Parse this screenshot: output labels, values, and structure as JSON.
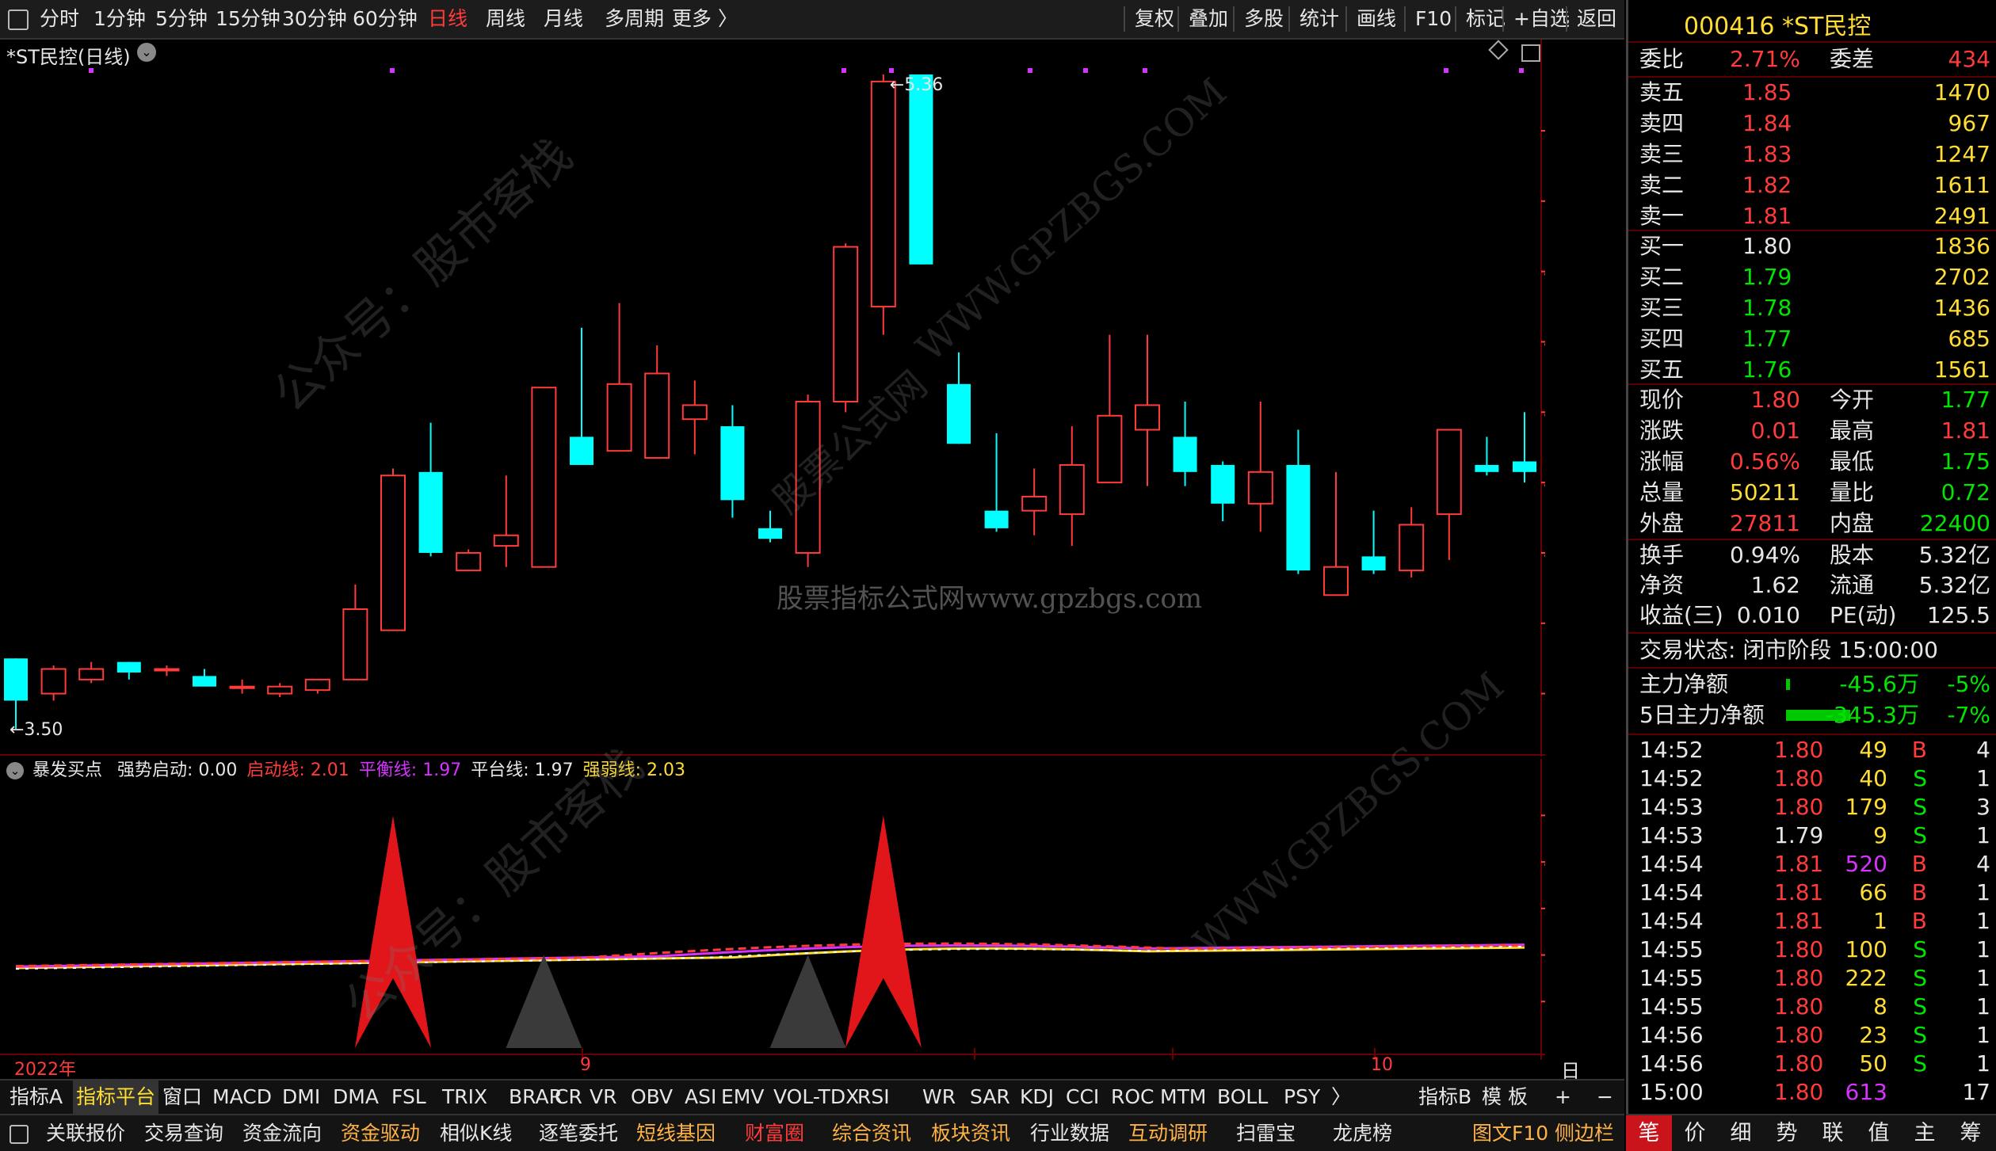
{
  "top_toolbar": {
    "periods": [
      "分时",
      "1分钟",
      "5分钟",
      "15分钟",
      "30分钟",
      "60分钟",
      "日线",
      "周线",
      "月线",
      "多周期",
      "更多 〉"
    ],
    "active_period": "日线",
    "right_buttons": [
      "复权",
      "叠加",
      "多股",
      "统计",
      "画线",
      "F10",
      "标记",
      "+自选",
      "返回"
    ]
  },
  "main_chart": {
    "title": "*ST民控(日线)",
    "high_label": "5.36",
    "low_label": "3.50",
    "price_ticks": [
      "5.20",
      "5.00",
      "4.80",
      "4.60",
      "4.40",
      "4.20",
      "4.00",
      "3.80",
      "3.60"
    ],
    "watermark_center": "股票指标公式网www.gpzbgs.com"
  },
  "indicator_legend": {
    "name": "暴发买点",
    "items": [
      {
        "label": "强势启动: 0.00",
        "color": "#e6e6e6"
      },
      {
        "label": "启动线: 2.01",
        "color": "#ff3b3b"
      },
      {
        "label": "平衡线: 1.97",
        "color": "#d633ff"
      },
      {
        "label": "平台线: 1.97",
        "color": "#e6e6e6"
      },
      {
        "label": "强弱线: 2.03",
        "color": "#ffdd33"
      }
    ],
    "ticks": [
      "5.00",
      "4.00",
      "3.00",
      "2.00",
      "1.00"
    ]
  },
  "date_axis": {
    "labels": [
      "2022年",
      "9",
      "10"
    ],
    "period_label": "日线"
  },
  "chart_data": {
    "type": "candlestick",
    "title": "*ST民控(日线)",
    "ylim": [
      3.5,
      5.36
    ],
    "candles": [
      {
        "o": 3.7,
        "h": 3.7,
        "l": 3.5,
        "c": 3.58
      },
      {
        "o": 3.6,
        "h": 3.68,
        "l": 3.58,
        "c": 3.67
      },
      {
        "o": 3.64,
        "h": 3.69,
        "l": 3.63,
        "c": 3.67
      },
      {
        "o": 3.69,
        "h": 3.69,
        "l": 3.64,
        "c": 3.66
      },
      {
        "o": 3.67,
        "h": 3.68,
        "l": 3.65,
        "c": 3.67
      },
      {
        "o": 3.65,
        "h": 3.67,
        "l": 3.63,
        "c": 3.62
      },
      {
        "o": 3.62,
        "h": 3.64,
        "l": 3.6,
        "c": 3.62
      },
      {
        "o": 3.6,
        "h": 3.63,
        "l": 3.59,
        "c": 3.62
      },
      {
        "o": 3.61,
        "h": 3.64,
        "l": 3.6,
        "c": 3.64
      },
      {
        "o": 3.64,
        "h": 3.91,
        "l": 3.64,
        "c": 3.84
      },
      {
        "o": 3.78,
        "h": 4.24,
        "l": 3.78,
        "c": 4.22
      },
      {
        "o": 4.23,
        "h": 4.37,
        "l": 3.99,
        "c": 4.0
      },
      {
        "o": 3.95,
        "h": 4.01,
        "l": 3.95,
        "c": 4.0
      },
      {
        "o": 4.02,
        "h": 4.22,
        "l": 3.96,
        "c": 4.05
      },
      {
        "o": 3.96,
        "h": 4.47,
        "l": 3.96,
        "c": 4.47
      },
      {
        "o": 4.33,
        "h": 4.64,
        "l": 4.25,
        "c": 4.25
      },
      {
        "o": 4.29,
        "h": 4.71,
        "l": 4.29,
        "c": 4.48
      },
      {
        "o": 4.27,
        "h": 4.59,
        "l": 4.27,
        "c": 4.51
      },
      {
        "o": 4.38,
        "h": 4.49,
        "l": 4.28,
        "c": 4.42
      },
      {
        "o": 4.36,
        "h": 4.42,
        "l": 4.1,
        "c": 4.15
      },
      {
        "o": 4.07,
        "h": 4.12,
        "l": 4.03,
        "c": 4.04
      },
      {
        "o": 4.0,
        "h": 4.45,
        "l": 3.96,
        "c": 4.43
      },
      {
        "o": 4.43,
        "h": 4.88,
        "l": 4.4,
        "c": 4.87
      },
      {
        "o": 4.7,
        "h": 5.36,
        "l": 4.62,
        "c": 5.34
      },
      {
        "o": 5.36,
        "h": 5.36,
        "l": 4.82,
        "c": 4.82
      },
      {
        "o": 4.48,
        "h": 4.57,
        "l": 4.31,
        "c": 4.31
      },
      {
        "o": 4.12,
        "h": 4.34,
        "l": 4.06,
        "c": 4.07
      },
      {
        "o": 4.12,
        "h": 4.24,
        "l": 4.05,
        "c": 4.16
      },
      {
        "o": 4.11,
        "h": 4.36,
        "l": 4.02,
        "c": 4.25
      },
      {
        "o": 4.2,
        "h": 4.62,
        "l": 4.2,
        "c": 4.39
      },
      {
        "o": 4.35,
        "h": 4.62,
        "l": 4.19,
        "c": 4.42
      },
      {
        "o": 4.33,
        "h": 4.43,
        "l": 4.19,
        "c": 4.23
      },
      {
        "o": 4.25,
        "h": 4.26,
        "l": 4.09,
        "c": 4.14
      },
      {
        "o": 4.14,
        "h": 4.43,
        "l": 4.06,
        "c": 4.23
      },
      {
        "o": 4.25,
        "h": 4.35,
        "l": 3.94,
        "c": 3.95
      },
      {
        "o": 3.88,
        "h": 4.23,
        "l": 3.88,
        "c": 3.96
      },
      {
        "o": 3.99,
        "h": 4.12,
        "l": 3.94,
        "c": 3.95
      },
      {
        "o": 3.95,
        "h": 4.13,
        "l": 3.93,
        "c": 4.08
      },
      {
        "o": 4.11,
        "h": 4.35,
        "l": 3.98,
        "c": 4.35
      },
      {
        "o": 4.25,
        "h": 4.33,
        "l": 4.22,
        "c": 4.23
      },
      {
        "o": 4.26,
        "h": 4.4,
        "l": 4.2,
        "c": 4.23
      }
    ],
    "indicator": {
      "name": "暴发买点",
      "ylim": [
        0,
        5.5
      ],
      "spikes": [
        {
          "candle": 10,
          "value": 5.0,
          "color": "#e0161b"
        },
        {
          "candle": 23,
          "value": 5.0,
          "color": "#e0161b"
        },
        {
          "candle": 14,
          "value": 2.0,
          "color": "#3a3a3a"
        },
        {
          "candle": 21,
          "value": 2.0,
          "color": "#3a3a3a"
        }
      ]
    }
  },
  "quote_panel": {
    "stock": "000416 *ST民控",
    "weibi": {
      "l1": "委比",
      "v1": "2.71%",
      "l2": "委差",
      "v2": "434"
    },
    "asks": [
      {
        "label": "卖五",
        "price": "1.85",
        "vol": "1470"
      },
      {
        "label": "卖四",
        "price": "1.84",
        "vol": "967"
      },
      {
        "label": "卖三",
        "price": "1.83",
        "vol": "1247"
      },
      {
        "label": "卖二",
        "price": "1.82",
        "vol": "1611"
      },
      {
        "label": "卖一",
        "price": "1.81",
        "vol": "2491"
      }
    ],
    "bids": [
      {
        "label": "买一",
        "price": "1.80",
        "vol": "1836"
      },
      {
        "label": "买二",
        "price": "1.79",
        "vol": "2702"
      },
      {
        "label": "买三",
        "price": "1.78",
        "vol": "1436"
      },
      {
        "label": "买四",
        "price": "1.77",
        "vol": "685"
      },
      {
        "label": "买五",
        "price": "1.76",
        "vol": "1561"
      }
    ],
    "stats1": [
      {
        "l1": "现价",
        "v1": "1.80",
        "c1": "red",
        "l2": "今开",
        "v2": "1.77",
        "c2": "green"
      },
      {
        "l1": "涨跌",
        "v1": "0.01",
        "c1": "red",
        "l2": "最高",
        "v2": "1.81",
        "c2": "red"
      },
      {
        "l1": "涨幅",
        "v1": "0.56%",
        "c1": "red",
        "l2": "最低",
        "v2": "1.75",
        "c2": "green"
      },
      {
        "l1": "总量",
        "v1": "50211",
        "c1": "yellow",
        "l2": "量比",
        "v2": "0.72",
        "c2": "green"
      },
      {
        "l1": "外盘",
        "v1": "27811",
        "c1": "red",
        "l2": "内盘",
        "v2": "22400",
        "c2": "green"
      }
    ],
    "stats2": [
      {
        "l1": "换手",
        "v1": "0.94%",
        "l2": "股本",
        "v2": "5.32亿"
      },
      {
        "l1": "净资",
        "v1": "1.62",
        "l2": "流通",
        "v2": "5.32亿"
      },
      {
        "l1": "收益(三)",
        "v1": "0.010",
        "l2": "PE(动)",
        "v2": "125.5"
      }
    ],
    "status": "交易状态: 闭市阶段 15:00:00",
    "capital": [
      {
        "label": "主力净额",
        "value": "-45.6万",
        "pct": "-5%",
        "bar": 0.05
      },
      {
        "label": "5日主力净额",
        "value": "-345.3万",
        "pct": "-7%",
        "bar": 0.9
      }
    ],
    "ticks": [
      {
        "t": "14:52",
        "p": "1.80",
        "v": "49",
        "s": "B",
        "n": "4",
        "vc": "yellow"
      },
      {
        "t": "14:52",
        "p": "1.80",
        "v": "40",
        "s": "S",
        "n": "1",
        "vc": "yellow"
      },
      {
        "t": "14:53",
        "p": "1.80",
        "v": "179",
        "s": "S",
        "n": "3",
        "vc": "yellow"
      },
      {
        "t": "14:53",
        "p": "1.79",
        "v": "9",
        "s": "S",
        "n": "1",
        "vc": "yellow"
      },
      {
        "t": "14:54",
        "p": "1.81",
        "v": "520",
        "s": "B",
        "n": "4",
        "vc": "purple"
      },
      {
        "t": "14:54",
        "p": "1.81",
        "v": "66",
        "s": "B",
        "n": "1",
        "vc": "yellow"
      },
      {
        "t": "14:54",
        "p": "1.81",
        "v": "1",
        "s": "B",
        "n": "1",
        "vc": "yellow"
      },
      {
        "t": "14:55",
        "p": "1.80",
        "v": "100",
        "s": "S",
        "n": "1",
        "vc": "yellow"
      },
      {
        "t": "14:55",
        "p": "1.80",
        "v": "222",
        "s": "S",
        "n": "1",
        "vc": "yellow"
      },
      {
        "t": "14:55",
        "p": "1.80",
        "v": "8",
        "s": "S",
        "n": "1",
        "vc": "yellow"
      },
      {
        "t": "14:56",
        "p": "1.80",
        "v": "23",
        "s": "S",
        "n": "1",
        "vc": "yellow"
      },
      {
        "t": "14:56",
        "p": "1.80",
        "v": "50",
        "s": "S",
        "n": "1",
        "vc": "yellow"
      },
      {
        "t": "15:00",
        "p": "1.80",
        "v": "613",
        "s": "",
        "n": "17",
        "vc": "purple"
      }
    ]
  },
  "indicator_tabs": {
    "items": [
      "指标A",
      "指标平台",
      "窗口",
      "MACD",
      "DMI",
      "DMA",
      "FSL",
      "TRIX",
      "BRAR",
      "CR",
      "VR",
      "OBV",
      "ASI",
      "EMV",
      "VOL-TDX",
      "RSI",
      "WR",
      "SAR",
      "KDJ",
      "CCI",
      "ROC",
      "MTM",
      "BOLL",
      "PSY",
      "〉"
    ],
    "active": "指标平台",
    "right": [
      "指标B",
      "模 板",
      "+",
      "−"
    ]
  },
  "function_bar": {
    "items": [
      {
        "label": "关联报价",
        "color": "#e6e6e6"
      },
      {
        "label": "交易查询",
        "color": "#e6e6e6"
      },
      {
        "label": "资金流向",
        "color": "#e6e6e6"
      },
      {
        "label": "资金驱动",
        "color": "#ffb347"
      },
      {
        "label": "相似K线",
        "color": "#e6e6e6"
      },
      {
        "label": "逐笔委托",
        "color": "#e6e6e6"
      },
      {
        "label": "短线基因",
        "color": "#ffb347"
      },
      {
        "label": "财富圈",
        "color": "#ff3b3b"
      },
      {
        "label": "综合资讯",
        "color": "#ffb347"
      },
      {
        "label": "板块资讯",
        "color": "#ffb347"
      },
      {
        "label": "行业数据",
        "color": "#e6e6e6"
      },
      {
        "label": "互动调研",
        "color": "#ffb347"
      },
      {
        "label": "扫雷宝",
        "color": "#e6e6e6"
      },
      {
        "label": "龙虎榜",
        "color": "#e6e6e6"
      }
    ],
    "right": [
      "图文F10",
      "侧边栏"
    ]
  },
  "right_tabs": [
    "笔",
    "价",
    "细",
    "势",
    "联",
    "值",
    "主",
    "筹"
  ],
  "watermarks": [
    "公众号：股市客栈",
    "WWW.GPZBGS.COM",
    "股票公式网",
    "公众号：股市客栈",
    "WWW.GPZBGS.COM",
    "股市客栈"
  ],
  "colors": {
    "up": "#ff3b3b",
    "down": "#00ffff",
    "grid": "#6b0000",
    "axis": "#ff3b3b"
  }
}
